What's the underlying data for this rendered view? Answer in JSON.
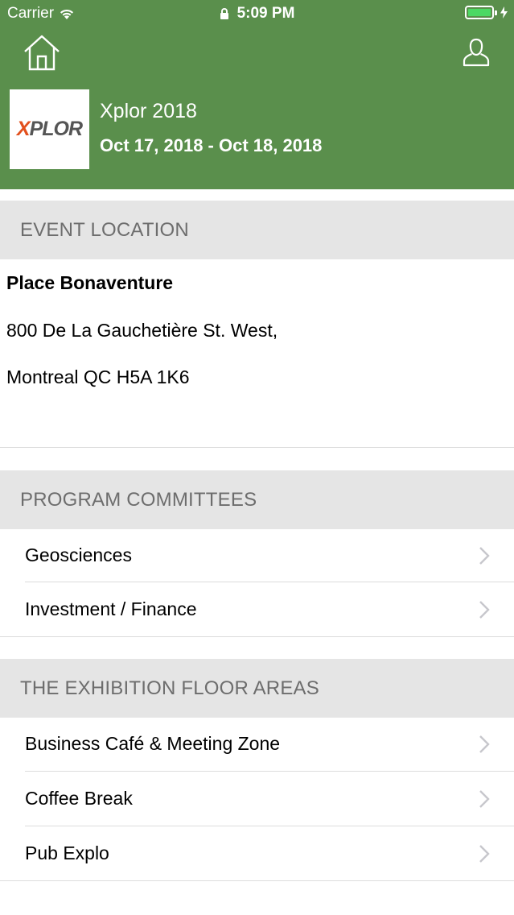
{
  "status_bar": {
    "carrier": "Carrier",
    "time": "5:09 PM",
    "battery_color": "#4cd964"
  },
  "header": {
    "background_color": "#5a8f4c",
    "logo_text_accent": "X",
    "logo_text_rest": "PLOR",
    "event_title": "Xplor 2018",
    "event_dates": "Oct 17, 2018 - Oct 18, 2018",
    "icons": [
      "home-icon",
      "profile-icon"
    ]
  },
  "location": {
    "section_title": "EVENT LOCATION",
    "venue": "Place Bonaventure",
    "address_line1": "800 De La Gauchetière St. West,",
    "address_line2": "Montreal QC H5A 1K6"
  },
  "program_committees": {
    "section_title": "PROGRAM COMMITTEES",
    "items": [
      {
        "label": "Geosciences"
      },
      {
        "label": "Investment / Finance"
      }
    ]
  },
  "floor_areas": {
    "section_title": "THE EXHIBITION FLOOR AREAS",
    "items": [
      {
        "label": "Business Café & Meeting Zone"
      },
      {
        "label": "Coffee Break"
      },
      {
        "label": "Pub Explo"
      }
    ]
  }
}
